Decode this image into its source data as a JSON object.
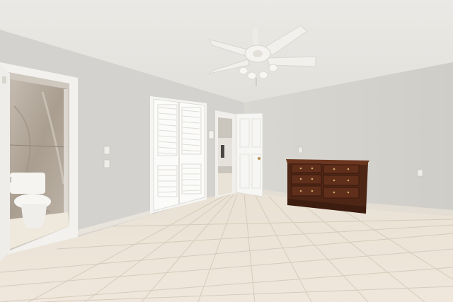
{
  "scene": {
    "description_free": true,
    "colors": {
      "ceiling": "#eceae6",
      "wall_left": "#d6d4d0",
      "wall_back": "#dcdad5",
      "wall_right": "#d8d6d2",
      "floor_tile": "#ece3d6",
      "grout": "#cfc5b6",
      "door_white": "#f4f4f2",
      "dresser_wood": "#5a2c1a",
      "bath_marble": "#b8aea2",
      "fan_white": "#f1efea"
    }
  }
}
